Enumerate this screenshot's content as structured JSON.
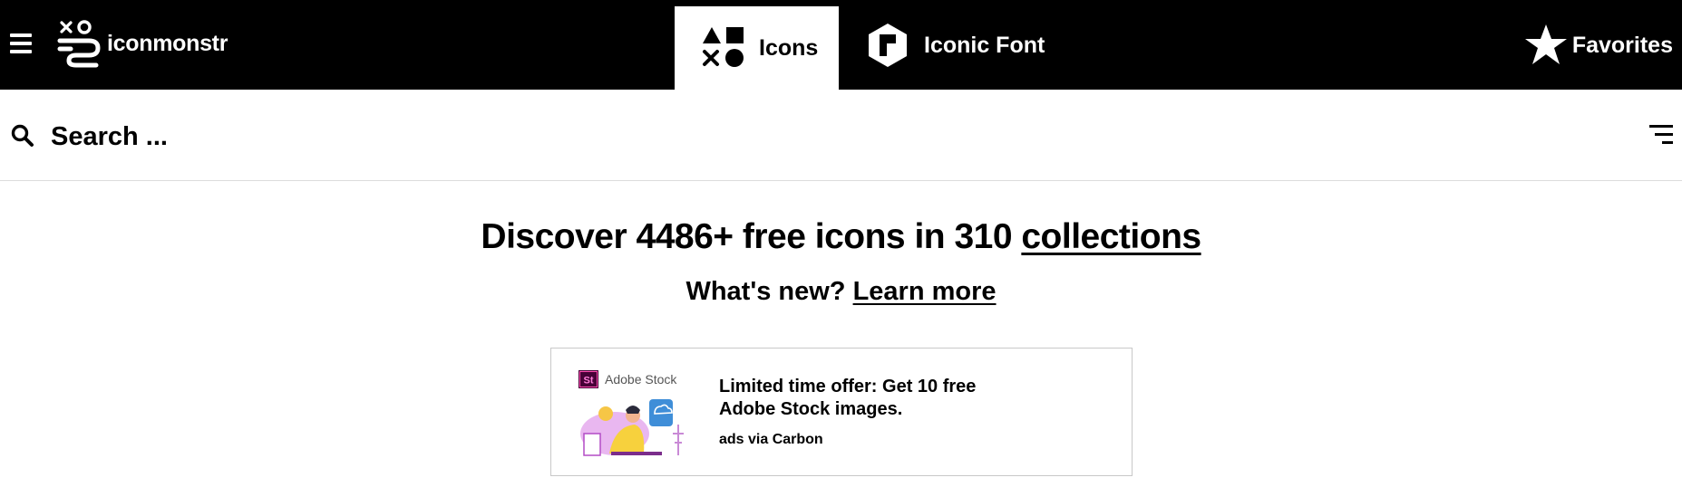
{
  "nav": {
    "brand": "iconmonstr",
    "tabs": [
      {
        "label": "Icons",
        "icon": "shapes-icon",
        "active": true
      },
      {
        "label": "Iconic Font",
        "icon": "font-hexagon-icon",
        "active": false
      }
    ],
    "favorites_label": "Favorites",
    "colors": {
      "bar": "#000000",
      "active_tab": "#ffffff",
      "text": "#ffffff"
    }
  },
  "search": {
    "placeholder": "Search ...",
    "value": ""
  },
  "hero": {
    "title_prefix": "Discover 4486+ free icons in 310 ",
    "title_link": "collections",
    "sub_prefix": "What's new? ",
    "sub_link": "Learn more"
  },
  "ad": {
    "brand": "Adobe Stock",
    "brand_badge": "St",
    "text": "Limited time offer: Get 10 free Adobe Stock images.",
    "via": "ads via Carbon"
  }
}
